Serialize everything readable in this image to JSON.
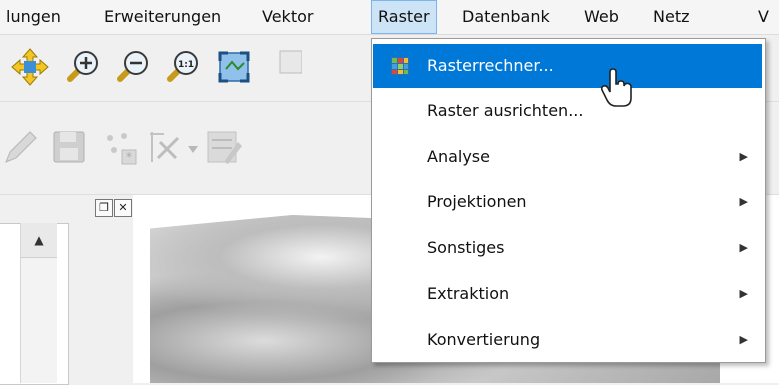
{
  "menubar": {
    "items": [
      {
        "label": "lungen"
      },
      {
        "label": "Erweiterungen"
      },
      {
        "label": "Vektor"
      },
      {
        "label": "Raster"
      },
      {
        "label": "Datenbank"
      },
      {
        "label": "Web"
      },
      {
        "label": "Netz"
      },
      {
        "label": "V"
      }
    ]
  },
  "raster_menu": {
    "items": [
      {
        "label": "Rasterrechner...",
        "icon": "raster-calculator-icon",
        "submenu": false
      },
      {
        "label": "Raster ausrichten...",
        "icon": "",
        "submenu": false
      },
      {
        "label": "Analyse",
        "submenu": true
      },
      {
        "label": "Projektionen",
        "submenu": true
      },
      {
        "label": "Sonstiges",
        "submenu": true
      },
      {
        "label": "Extraktion",
        "submenu": true
      },
      {
        "label": "Konvertierung",
        "submenu": true
      }
    ],
    "arrow_glyph": "▶"
  },
  "dock": {
    "scroll_up_glyph": "▲",
    "float_glyph": "❐",
    "close_glyph": "✕"
  },
  "colors": {
    "highlight": "#0078d7",
    "menu_active_bg": "#cde4f7"
  }
}
